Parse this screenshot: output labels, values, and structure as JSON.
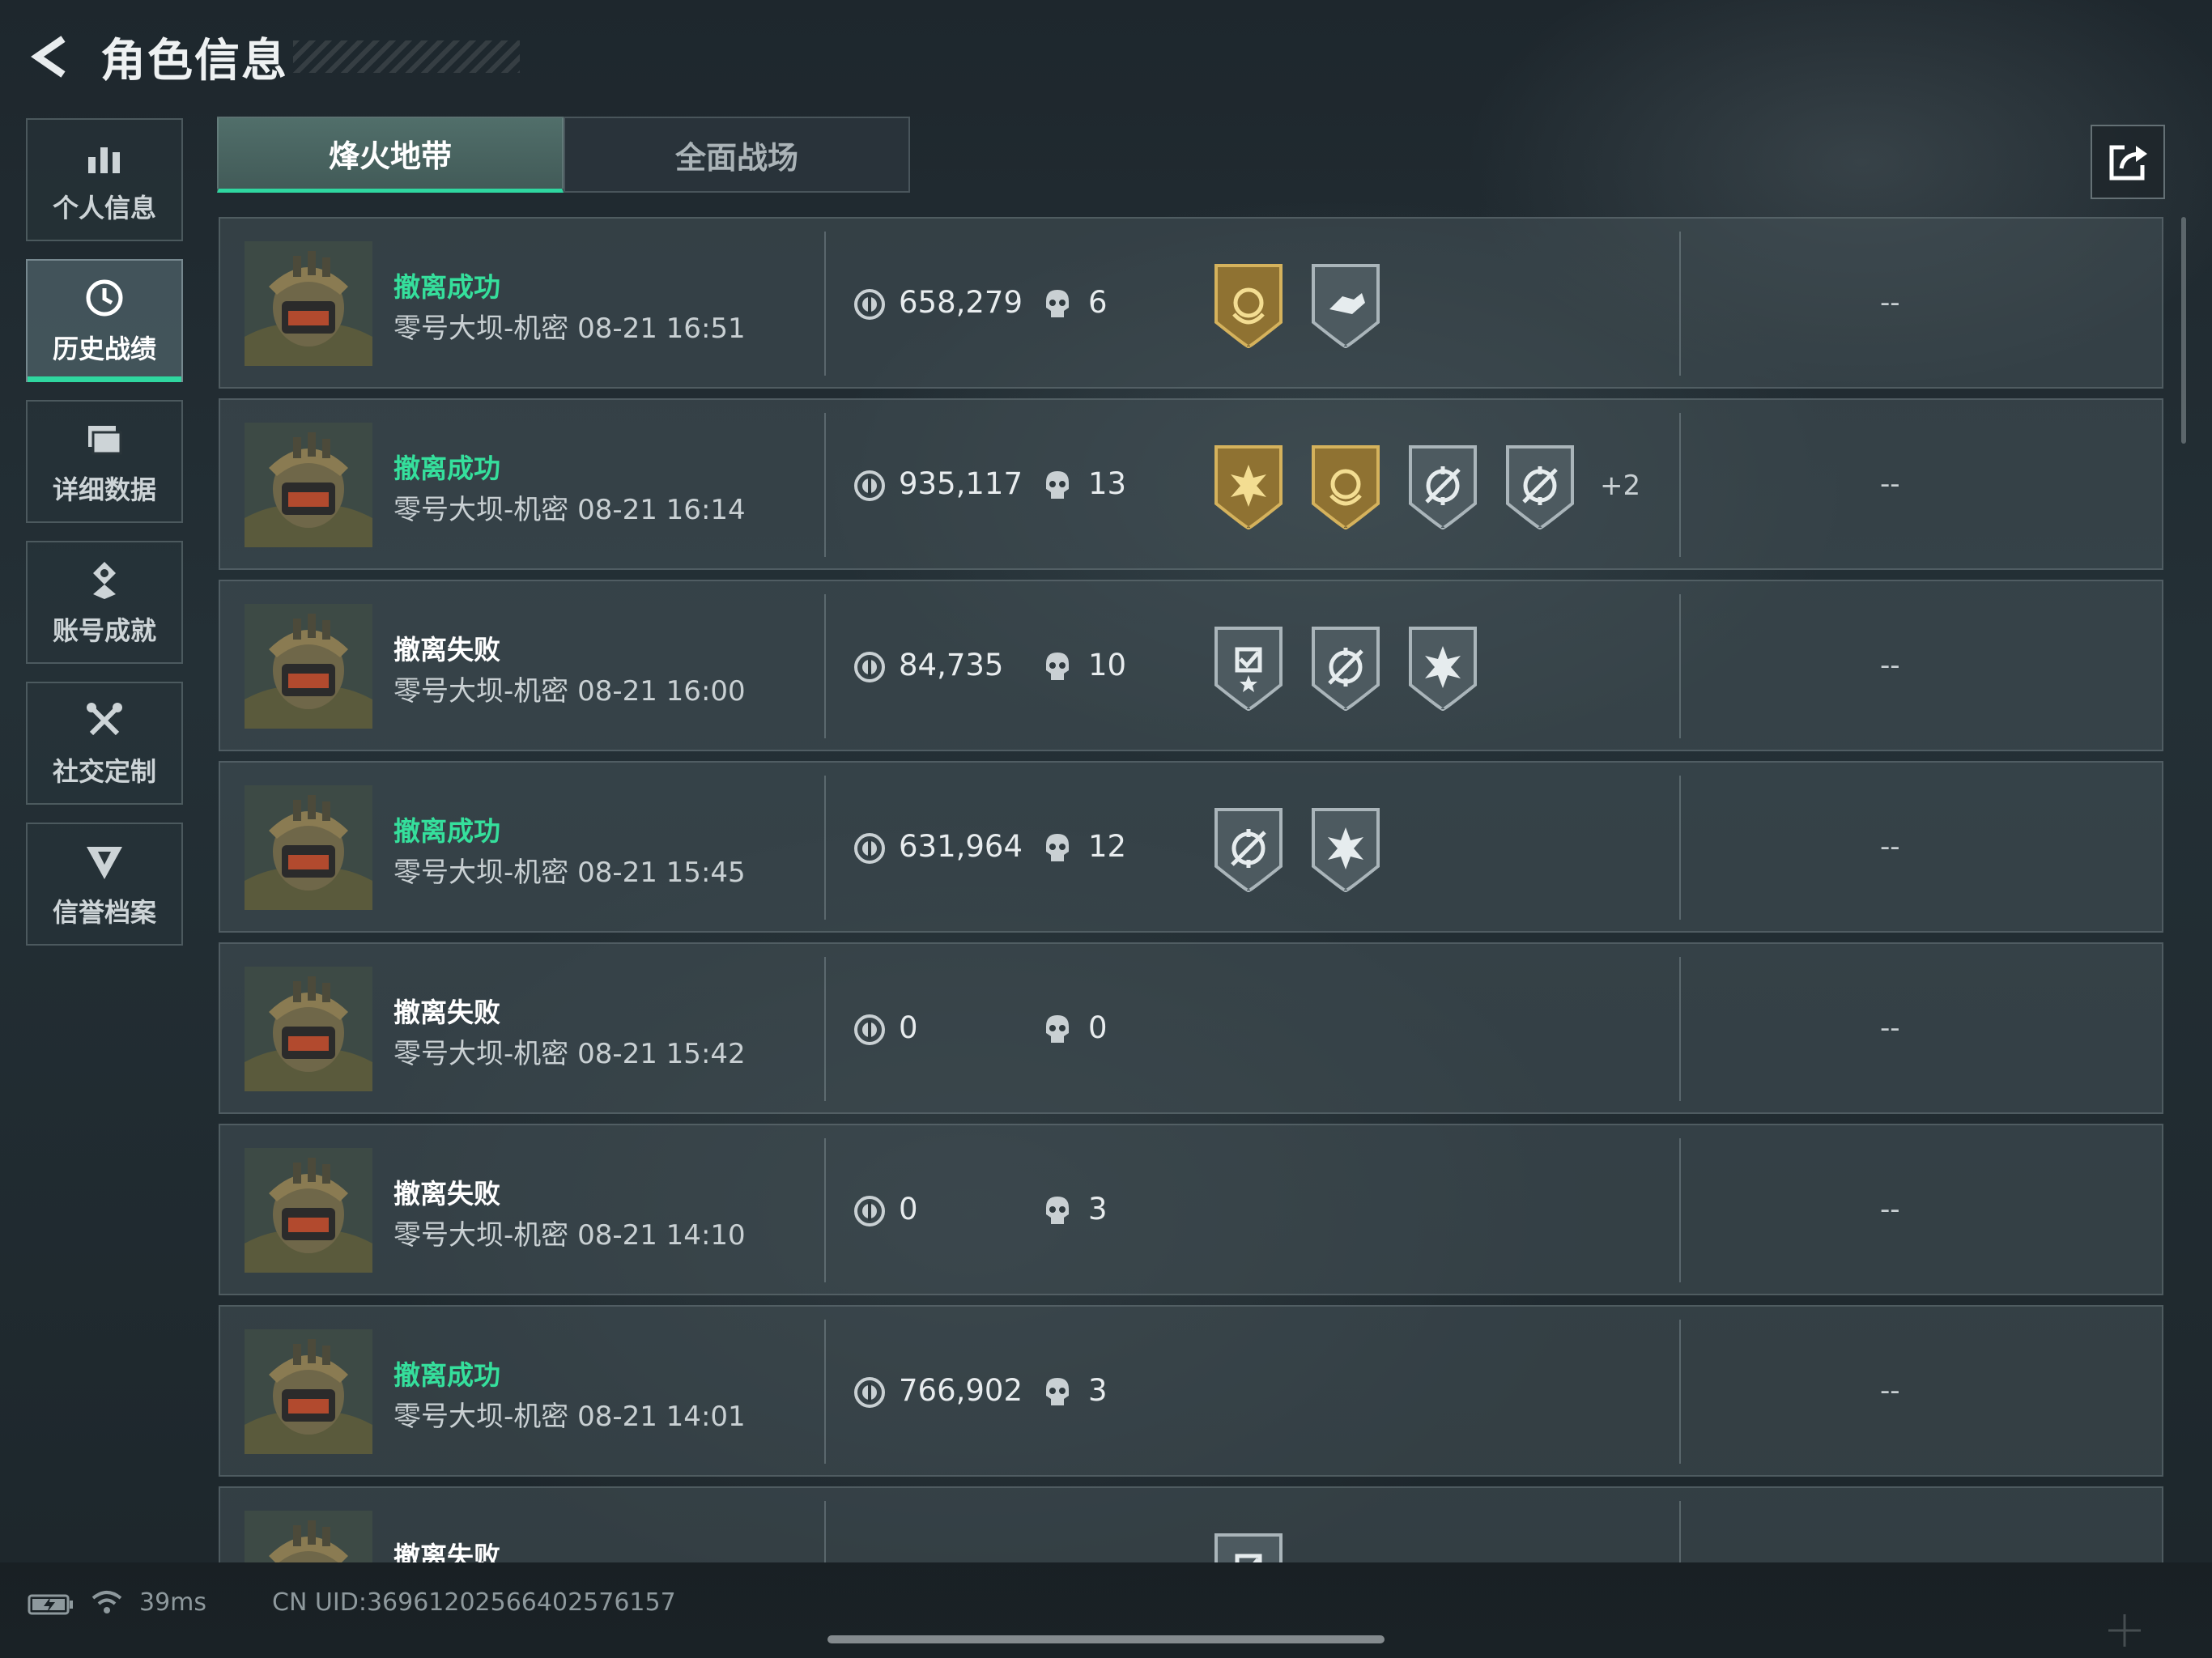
{
  "header": {
    "title": "角色信息",
    "back_icon": "back-arrow-icon"
  },
  "sidebar": {
    "items": [
      {
        "label": "个人信息",
        "icon": "bar-chart-icon",
        "active": false
      },
      {
        "label": "历史战绩",
        "icon": "history-clock-icon",
        "active": true
      },
      {
        "label": "详细数据",
        "icon": "folder-data-icon",
        "active": false
      },
      {
        "label": "账号成就",
        "icon": "achievement-icon",
        "active": false
      },
      {
        "label": "社交定制",
        "icon": "tools-icon",
        "active": false
      },
      {
        "label": "信誉档案",
        "icon": "credit-shield-icon",
        "active": false
      }
    ]
  },
  "tabs": [
    {
      "label": "烽火地带",
      "active": true
    },
    {
      "label": "全面战场",
      "active": false
    }
  ],
  "share_icon": "share-export-icon",
  "records": [
    {
      "status": "撤离成功",
      "success": true,
      "map_time": "零号大坝-机密 08-21 16:51",
      "value": "658,279",
      "kills": "6",
      "badges": [
        "gold-crest",
        "gray-hand"
      ],
      "more": "",
      "extra": "--"
    },
    {
      "status": "撤离成功",
      "success": true,
      "map_time": "零号大坝-机密 08-21 16:14",
      "value": "935,117",
      "kills": "13",
      "badges": [
        "gold-burst",
        "gold-crest",
        "gray-crosshair",
        "gray-crosshair"
      ],
      "more": "+2",
      "extra": "--"
    },
    {
      "status": "撤离失败",
      "success": false,
      "map_time": "零号大坝-机密 08-21 16:00",
      "value": "84,735",
      "kills": "10",
      "badges": [
        "gray-check",
        "gray-crosshair",
        "gray-burst"
      ],
      "more": "",
      "extra": "--"
    },
    {
      "status": "撤离成功",
      "success": true,
      "map_time": "零号大坝-机密 08-21 15:45",
      "value": "631,964",
      "kills": "12",
      "badges": [
        "gray-crosshair",
        "gray-burst"
      ],
      "more": "",
      "extra": "--"
    },
    {
      "status": "撤离失败",
      "success": false,
      "map_time": "零号大坝-机密 08-21 15:42",
      "value": "0",
      "kills": "0",
      "badges": [],
      "more": "",
      "extra": "--"
    },
    {
      "status": "撤离失败",
      "success": false,
      "map_time": "零号大坝-机密 08-21 14:10",
      "value": "0",
      "kills": "3",
      "badges": [],
      "more": "",
      "extra": "--"
    },
    {
      "status": "撤离成功",
      "success": true,
      "map_time": "零号大坝-机密 08-21 14:01",
      "value": "766,902",
      "kills": "3",
      "badges": [],
      "more": "",
      "extra": "--"
    },
    {
      "status": "撤离失败",
      "success": false,
      "map_time": "",
      "value": "",
      "kills": "",
      "badges": [
        "gray-check"
      ],
      "more": "",
      "extra": ""
    }
  ],
  "footer": {
    "ping": "39ms",
    "uid": "CN UID:36961202566402576157"
  },
  "colors": {
    "accent": "#2fd7a0",
    "success": "#35df9c",
    "fail": "#ffffff",
    "gold": "#b8953c"
  }
}
